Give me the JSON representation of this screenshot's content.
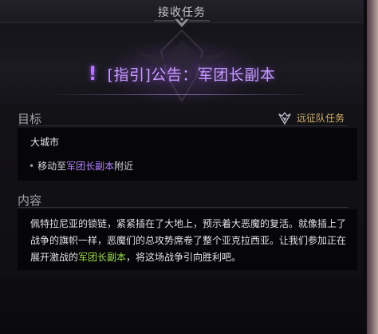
{
  "header": {
    "title": "接收任务"
  },
  "quest": {
    "marker": "!",
    "title": "[指引]公告：军团长副本"
  },
  "goal": {
    "label": "目标",
    "quest_type": "远征队任务",
    "location": "大城市",
    "step_bullet": "•",
    "step_prefix": "移动至",
    "step_highlight": "军团长副本",
    "step_suffix": "附近"
  },
  "content": {
    "label": "内容",
    "text_1": "佩特拉尼亚的锁链，紧紧插在了大地上，预示着大恶魔的复活。就像插上了战争的旗帜一样，恶魔们的总攻势席卷了整个亚克拉西亚。让我们参加正在展开激战的",
    "highlight": "军团长副本",
    "text_2": "，将这场战争引向胜利吧。"
  },
  "colors": {
    "accent_purple": "#b784ff",
    "accent_green": "#9fde4e",
    "accent_gold": "#d8b36a"
  },
  "icons": {
    "header_ornament": "ornament-icon",
    "quest_marker": "exclamation-icon",
    "expedition": "expedition-emblem-icon"
  }
}
